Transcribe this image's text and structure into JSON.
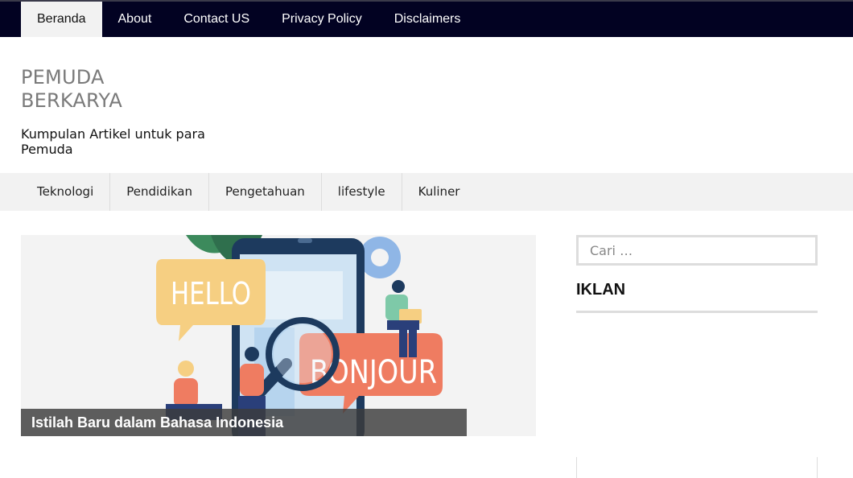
{
  "top_nav": {
    "items": [
      {
        "label": "Beranda"
      },
      {
        "label": "About"
      },
      {
        "label": "Contact US"
      },
      {
        "label": "Privacy Policy"
      },
      {
        "label": "Disclaimers"
      }
    ]
  },
  "header": {
    "site_title_line1": "PEMUDA",
    "site_title_line2": "BERKARYA",
    "site_desc_line1": "Kumpulan Artikel untuk para",
    "site_desc_line2": "Pemuda"
  },
  "category_nav": {
    "items": [
      {
        "label": "Teknologi"
      },
      {
        "label": "Pendidikan"
      },
      {
        "label": "Pengetahuan"
      },
      {
        "label": "lifestyle"
      },
      {
        "label": "Kuliner"
      }
    ]
  },
  "featured": {
    "title": "Istilah Baru dalam Bahasa Indonesia",
    "bubble_hello": "HELLO",
    "bubble_bonjour": "BONJOUR"
  },
  "sidebar": {
    "search_placeholder": "Cari …",
    "widget_title": "IKLAN"
  },
  "colors": {
    "top_nav_bg": "#020222",
    "active_tab_bg": "#f2f2f2",
    "category_bg": "#f2f2f2",
    "title_gray": "#7a7a7a"
  }
}
